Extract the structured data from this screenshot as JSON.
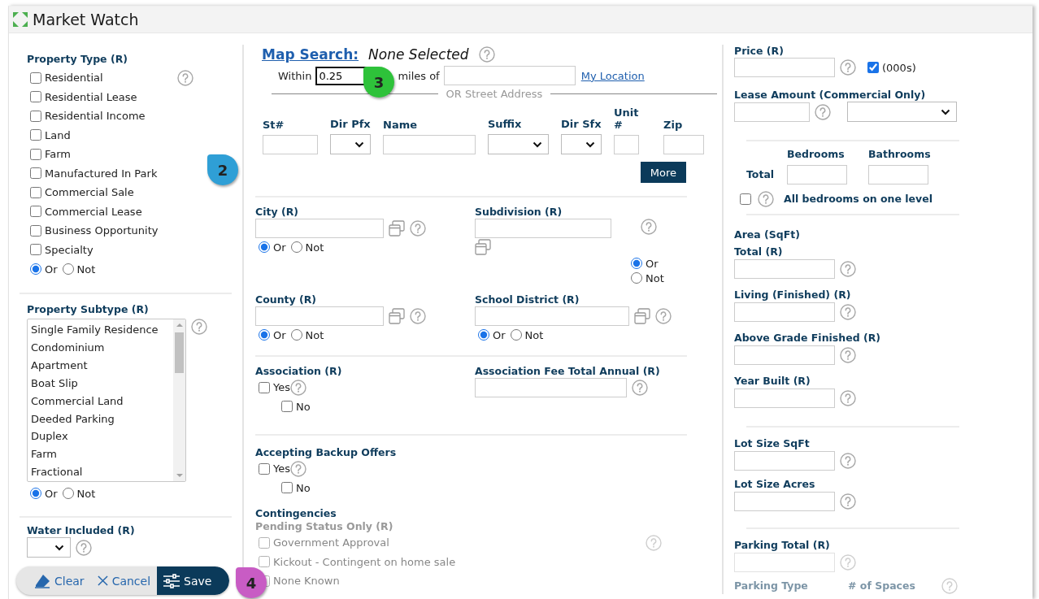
{
  "window": {
    "title": "Market Watch"
  },
  "property_type": {
    "label": "Property Type (R)",
    "options": [
      {
        "label": "Residential",
        "checked": false
      },
      {
        "label": "Residential Lease",
        "checked": false
      },
      {
        "label": "Residential Income",
        "checked": false
      },
      {
        "label": "Land",
        "checked": false
      },
      {
        "label": "Farm",
        "checked": false
      },
      {
        "label": "Manufactured In Park",
        "checked": false
      },
      {
        "label": "Commercial Sale",
        "checked": false
      },
      {
        "label": "Commercial Lease",
        "checked": false
      },
      {
        "label": "Business Opportunity",
        "checked": false
      },
      {
        "label": "Specialty",
        "checked": false
      }
    ],
    "mode": [
      {
        "label": "Or",
        "selected": true
      },
      {
        "label": "Not",
        "selected": false
      }
    ]
  },
  "property_subtype": {
    "label": "Property Subtype (R)",
    "items": [
      {
        "label": "Single Family Residence",
        "selected": false
      },
      {
        "label": "Condominium",
        "selected": false
      },
      {
        "label": "Apartment",
        "selected": false
      },
      {
        "label": "Boat Slip",
        "selected": false
      },
      {
        "label": "Commercial Land",
        "selected": false
      },
      {
        "label": "Deeded Parking",
        "selected": false
      },
      {
        "label": "Duplex",
        "selected": false
      },
      {
        "label": "Farm",
        "selected": false
      },
      {
        "label": "Fractional",
        "selected": false
      }
    ],
    "mode": [
      {
        "label": "Or",
        "selected": true
      },
      {
        "label": "Not",
        "selected": false
      }
    ]
  },
  "water_included": {
    "label": "Water Included (R)"
  },
  "map_search": {
    "link": "Map Search:",
    "status": "None Selected",
    "within": "Within",
    "radius": "0.25",
    "miles_of": "miles of",
    "my_location": "My Location",
    "separator": "OR Street Address"
  },
  "address_fields": [
    {
      "label": "St#",
      "kind": "text"
    },
    {
      "label": "Dir Pfx",
      "kind": "select"
    },
    {
      "label": "Name",
      "kind": "text"
    },
    {
      "label": "Suffix",
      "kind": "select"
    },
    {
      "label": "Dir Sfx",
      "kind": "select"
    },
    {
      "label": "Unit #",
      "kind": "text"
    },
    {
      "label": "Zip",
      "kind": "text"
    }
  ],
  "more_button": "More",
  "location_rows": [
    [
      {
        "label": "City (R)",
        "kind": "inline",
        "mode": [
          {
            "label": "Or",
            "selected": true
          },
          {
            "label": "Not",
            "selected": false
          }
        ]
      },
      {
        "label": "Subdivision (R)",
        "kind": "stacked",
        "mode": [
          {
            "label": "Or",
            "selected": true
          },
          {
            "label": "Not",
            "selected": false
          }
        ]
      }
    ],
    [
      {
        "label": "County (R)",
        "kind": "inline",
        "mode": [
          {
            "label": "Or",
            "selected": true
          },
          {
            "label": "Not",
            "selected": false
          }
        ]
      },
      {
        "label": "School District (R)",
        "kind": "inline",
        "mode": [
          {
            "label": "Or",
            "selected": true
          },
          {
            "label": "Not",
            "selected": false
          }
        ]
      }
    ]
  ],
  "association": {
    "label": "Association (R)",
    "options": [
      {
        "label": "Yes",
        "checked": false
      },
      {
        "label": "No",
        "checked": false
      }
    ]
  },
  "association_fee": {
    "label": "Association Fee Total Annual (R)"
  },
  "backup_offers": {
    "label": "Accepting Backup Offers",
    "options": [
      {
        "label": "Yes",
        "checked": false
      },
      {
        "label": "No",
        "checked": false
      }
    ]
  },
  "contingencies": {
    "label": "Contingencies",
    "sublabel": "Pending Status Only (R)",
    "options": [
      {
        "label": "Government Approval",
        "checked": false,
        "faded": true
      },
      {
        "label": "Kickout - Contingent on home sale",
        "checked": false,
        "faded": true
      },
      {
        "label": "None Known",
        "checked": false,
        "faded": true
      }
    ]
  },
  "price": {
    "label": "Price (R)",
    "units_label": "(000s)",
    "units_checked": true
  },
  "lease_amount": {
    "label": "Lease Amount (Commercial Only)"
  },
  "rooms": {
    "columns": [
      "Bedrooms",
      "Bathrooms"
    ],
    "row_label": "Total",
    "one_level": {
      "label": "All bedrooms on one level",
      "checked": false
    }
  },
  "area": {
    "label": "Area (SqFt)",
    "fields": [
      {
        "label": "Total (R)"
      },
      {
        "label": "Living (Finished) (R)"
      },
      {
        "label": "Above Grade Finished (R)"
      },
      {
        "label": "Year Built (R)"
      }
    ]
  },
  "lot_size": {
    "fields": [
      {
        "label": "Lot Size SqFt"
      },
      {
        "label": "Lot Size Acres"
      }
    ]
  },
  "parking": {
    "label": "Parking Total (R)",
    "columns": [
      {
        "label": "Parking Type",
        "faded": true
      },
      {
        "label": "# of Spaces",
        "faded": true
      }
    ]
  },
  "actions": [
    {
      "label": "Clear",
      "kind": "clear"
    },
    {
      "label": "Cancel",
      "kind": "cancel"
    },
    {
      "label": "Save",
      "kind": "save"
    }
  ],
  "callouts": [
    {
      "label": "2",
      "color": "#2f9fd6"
    },
    {
      "label": "3",
      "color": "#2ec23a"
    },
    {
      "label": "4",
      "color": "#c85cc4"
    }
  ]
}
